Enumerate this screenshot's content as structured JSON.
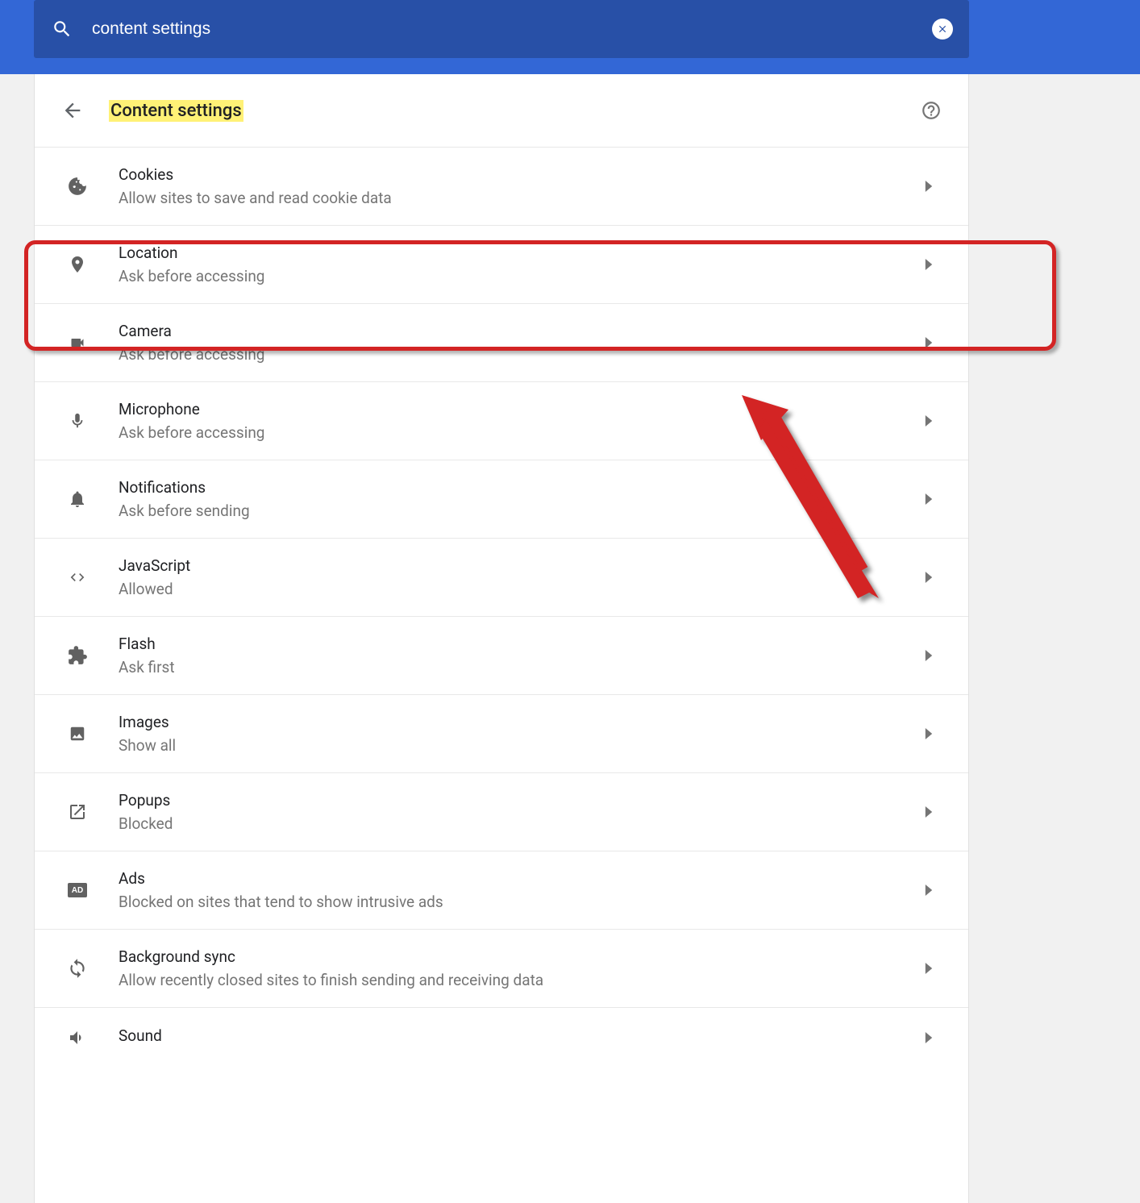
{
  "search": {
    "value": "content settings"
  },
  "header": {
    "title": "Content settings"
  },
  "settings": [
    {
      "id": "cookies",
      "title": "Cookies",
      "desc": "Allow sites to save and read cookie data"
    },
    {
      "id": "location",
      "title": "Location",
      "desc": "Ask before accessing"
    },
    {
      "id": "camera",
      "title": "Camera",
      "desc": "Ask before accessing"
    },
    {
      "id": "microphone",
      "title": "Microphone",
      "desc": "Ask before accessing"
    },
    {
      "id": "notifications",
      "title": "Notifications",
      "desc": "Ask before sending"
    },
    {
      "id": "javascript",
      "title": "JavaScript",
      "desc": "Allowed"
    },
    {
      "id": "flash",
      "title": "Flash",
      "desc": "Ask first"
    },
    {
      "id": "images",
      "title": "Images",
      "desc": "Show all"
    },
    {
      "id": "popups",
      "title": "Popups",
      "desc": "Blocked"
    },
    {
      "id": "ads",
      "title": "Ads",
      "desc": "Blocked on sites that tend to show intrusive ads"
    },
    {
      "id": "background-sync",
      "title": "Background sync",
      "desc": "Allow recently closed sites to finish sending and receiving data"
    },
    {
      "id": "sound",
      "title": "Sound",
      "desc": ""
    }
  ]
}
